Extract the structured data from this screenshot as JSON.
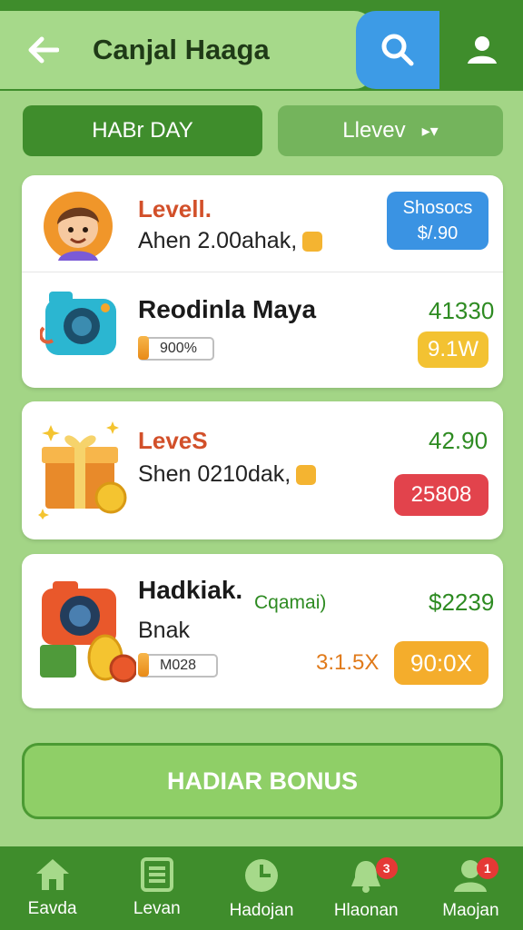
{
  "header": {
    "title": "Canjal Haaga",
    "icons": {
      "back": "back-arrow-icon",
      "search": "search-icon",
      "profile": "profile-icon"
    }
  },
  "tabs": [
    {
      "label": "HABr DAY",
      "active": true
    },
    {
      "label": "Llevev",
      "suffix": "▸▾",
      "active": false
    }
  ],
  "cards": [
    {
      "title": "Levell.",
      "subtitle": "Ahen 2.00ahak,",
      "action_line1": "Shosocs",
      "action_line2": "$/.90",
      "icon": "boy-avatar-icon"
    },
    {
      "title": "Reodinla Maya",
      "value": "41330",
      "progress_label": "900%",
      "action": "9.1W",
      "icon": "camera-icon"
    },
    {
      "title": "LeveS",
      "subtitle": "Shen 0210dak,",
      "value": "42.90",
      "action": "25808",
      "icon": "gift-box-icon"
    },
    {
      "title": "Hadkiak.",
      "tag": "Cqamai)",
      "subtitle": "Bnak",
      "progress_label": "M028",
      "value": "$2239",
      "multiplier": "3:1.5X",
      "action": "90:0X",
      "icon": "camera-coins-icon"
    }
  ],
  "bonus_button": "HADIAR BONUS",
  "bottom_nav": [
    {
      "label": "Eavda",
      "icon": "home-icon",
      "badge": ""
    },
    {
      "label": "Levan",
      "icon": "list-icon",
      "badge": ""
    },
    {
      "label": "Hadojan",
      "icon": "clock-icon",
      "badge": ""
    },
    {
      "label": "Hlaonan",
      "icon": "bell-icon",
      "badge": "3"
    },
    {
      "label": "Maojan",
      "icon": "user-icon",
      "badge": "1"
    }
  ],
  "colors": {
    "primary": "#3f8d2c",
    "background": "#a3d586",
    "accent_blue": "#3a93e3",
    "accent_red": "#e2434c",
    "accent_yellow": "#f3c232",
    "accent_orange": "#f4ad2c"
  }
}
